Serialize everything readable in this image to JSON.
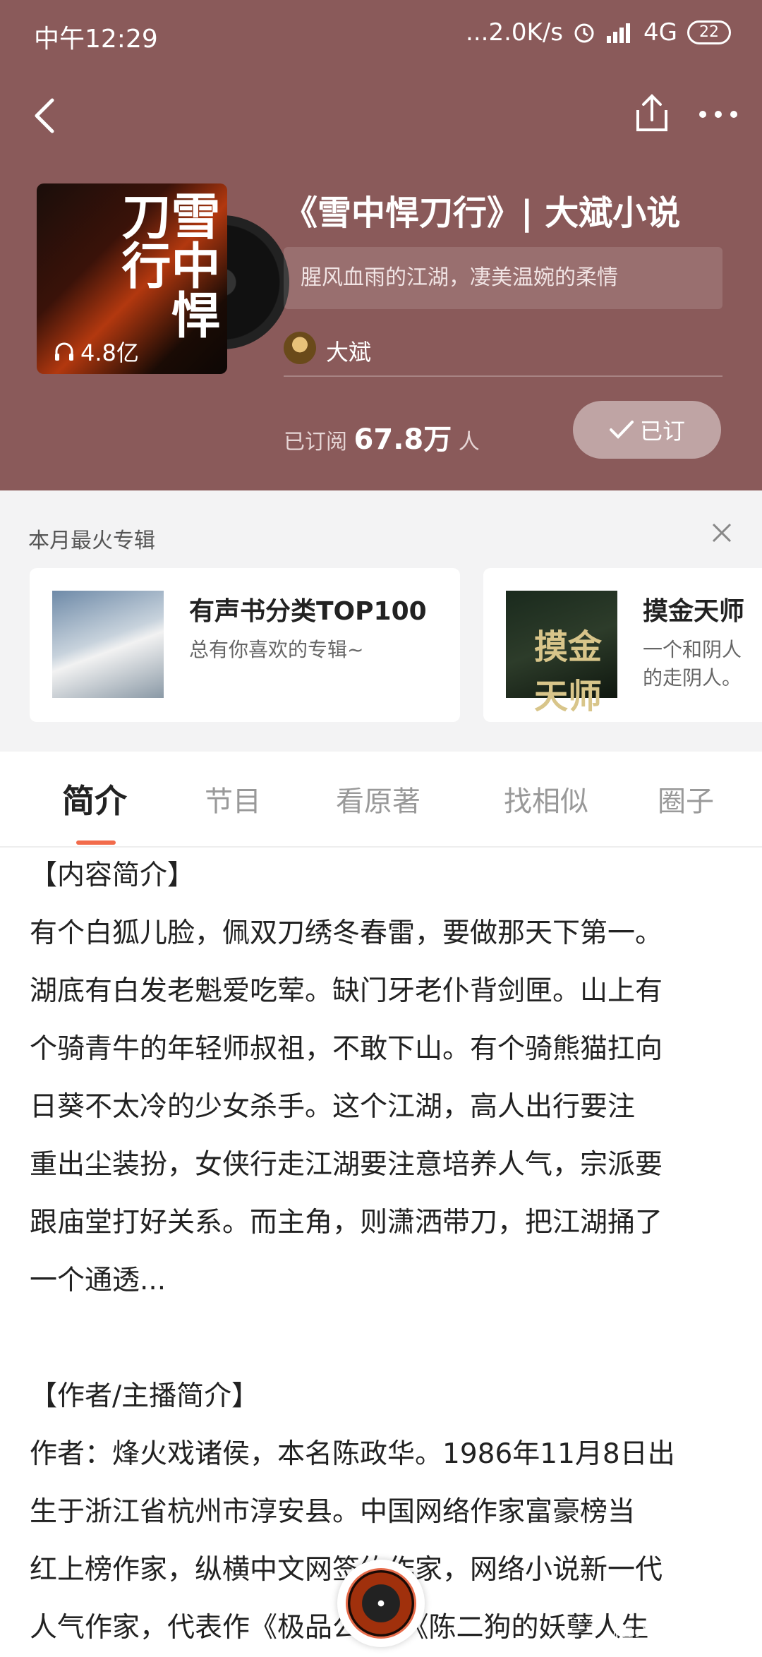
{
  "status_bar": {
    "time": "中午12:29",
    "network": "...2.0K/s",
    "signal": "4G",
    "battery": "22"
  },
  "header": {
    "back_icon": "back-arrow-icon",
    "share_icon": "share-icon",
    "more_icon": "more-dots-icon"
  },
  "album": {
    "plays": "4.8亿",
    "cover_title": "雪中悍刀行",
    "title": "《雪中悍刀行》| 大斌小说",
    "tagline": "腥风血雨的江湖，凄美温婉的柔情",
    "author": "大斌",
    "subscribed_prefix": "已订阅",
    "subscribed_count": "67.8万",
    "subscribed_suffix": "人",
    "subscribe_button": "已订"
  },
  "hot_albums": {
    "title": "本月最火专辑",
    "items": [
      {
        "name": "有声书分类TOP100",
        "desc": "总有你喜欢的专辑~"
      },
      {
        "name": "摸金天师",
        "desc_line1": "一个和阴人",
        "desc_line2": "的走阴人。",
        "cover_text": "摸金天师"
      }
    ]
  },
  "tabs": [
    "简介",
    "节目",
    "看原著",
    "找相似",
    "圈子"
  ],
  "intro": {
    "section1_title": "【内容简介】",
    "section1_lines": [
      "有个白狐儿脸，佩双刀绣冬春雷，要做那天下第一。",
      "湖底有白发老魁爱吃荤。缺门牙老仆背剑匣。山上有",
      "个骑青牛的年轻师叔祖，不敢下山。有个骑熊猫扛向",
      "日葵不太冷的少女杀手。这个江湖，高人出行要注",
      "重出尘装扮，女侠行走江湖要注意培养人气，宗派要",
      "跟庙堂打好关系。而主角，则潇洒带刀，把江湖捅了",
      "一个通透..."
    ],
    "section2_title": "【作者/主播简介】",
    "section2_lines": [
      "作者：烽火戏诸侯，本名陈政华。1986年11月8日出",
      "生于浙江省杭州市淳安县。中国网络作家富豪榜当",
      "红上榜作家，纵横中文网签约作家，网络小说新一代",
      "人气作家，代表作《极品公子》《陈二狗的妖孽人生"
    ]
  },
  "watermark": "悟空问答",
  "colors": {
    "hero_bg": "#8a5a5a",
    "accent": "#f26b4b",
    "page_bg": "#f3f3f4"
  }
}
